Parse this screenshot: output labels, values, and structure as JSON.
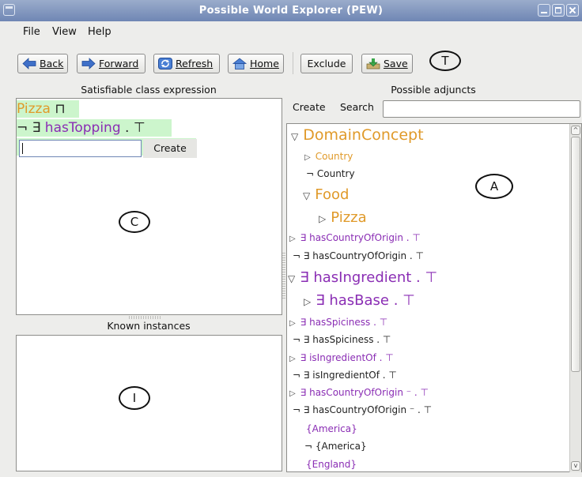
{
  "window": {
    "title": "Possible World Explorer (PEW)"
  },
  "menu": {
    "file": "File",
    "view": "View",
    "help": "Help"
  },
  "toolbar": {
    "back": "Back",
    "forward": "Forward",
    "refresh": "Refresh",
    "home": "Home",
    "exclude": "Exclude",
    "save": "Save",
    "marker": "T"
  },
  "left": {
    "header": "Satisfiable class expression",
    "expr1_class": "Pizza",
    "expr1_op": "⊓",
    "expr2_neg": "¬ ∃",
    "expr2_prop": "hasTopping",
    "expr2_rest": ". ⊤",
    "input_value": "",
    "create_label": "Create",
    "marker": "C",
    "instances_header": "Known instances",
    "instances_marker": "I"
  },
  "right": {
    "header": "Possible adjuncts",
    "tab_create": "Create",
    "tab_search": "Search",
    "search_value": "",
    "marker": "A",
    "tree": [
      {
        "text": "DomainConcept",
        "toggle": "▽",
        "color": "orange"
      },
      {
        "text": "Country",
        "toggle": "▷",
        "color": "orange"
      },
      {
        "text": "¬ Country",
        "toggle": "",
        "color": "dark"
      },
      {
        "text": "Food",
        "toggle": "▽",
        "color": "orange"
      },
      {
        "text": "Pizza",
        "toggle": "▷",
        "color": "orange"
      },
      {
        "text": "∃ hasCountryOfOrigin . ⊤",
        "toggle": "▷",
        "color": "purple"
      },
      {
        "text": "¬ ∃ hasCountryOfOrigin . ⊤",
        "toggle": "",
        "color": "dark"
      },
      {
        "text": "∃ hasIngredient . ⊤",
        "toggle": "▽",
        "color": "purple"
      },
      {
        "text": "∃ hasBase . ⊤",
        "toggle": "▷",
        "color": "purple"
      },
      {
        "text": "∃ hasSpiciness . ⊤",
        "toggle": "▷",
        "color": "purple"
      },
      {
        "text": "¬ ∃ hasSpiciness . ⊤",
        "toggle": "",
        "color": "dark"
      },
      {
        "text": "∃ isIngredientOf . ⊤",
        "toggle": "▷",
        "color": "purple"
      },
      {
        "text": "¬ ∃ isIngredientOf . ⊤",
        "toggle": "",
        "color": "dark"
      },
      {
        "text": "∃ hasCountryOfOrigin ⁻ . ⊤",
        "toggle": "▷",
        "color": "purple"
      },
      {
        "text": "¬ ∃ hasCountryOfOrigin ⁻ . ⊤",
        "toggle": "",
        "color": "dark"
      },
      {
        "text": "{America}",
        "toggle": "",
        "color": "purple"
      },
      {
        "text": "¬ {America}",
        "toggle": "",
        "color": "dark"
      },
      {
        "text": "{England}",
        "toggle": "",
        "color": "purple"
      }
    ]
  },
  "colors": {
    "orange": "#e09a2a",
    "purple": "#8a2db4",
    "highlight": "#ccf5cc",
    "titlebar": "#7f95bf"
  }
}
